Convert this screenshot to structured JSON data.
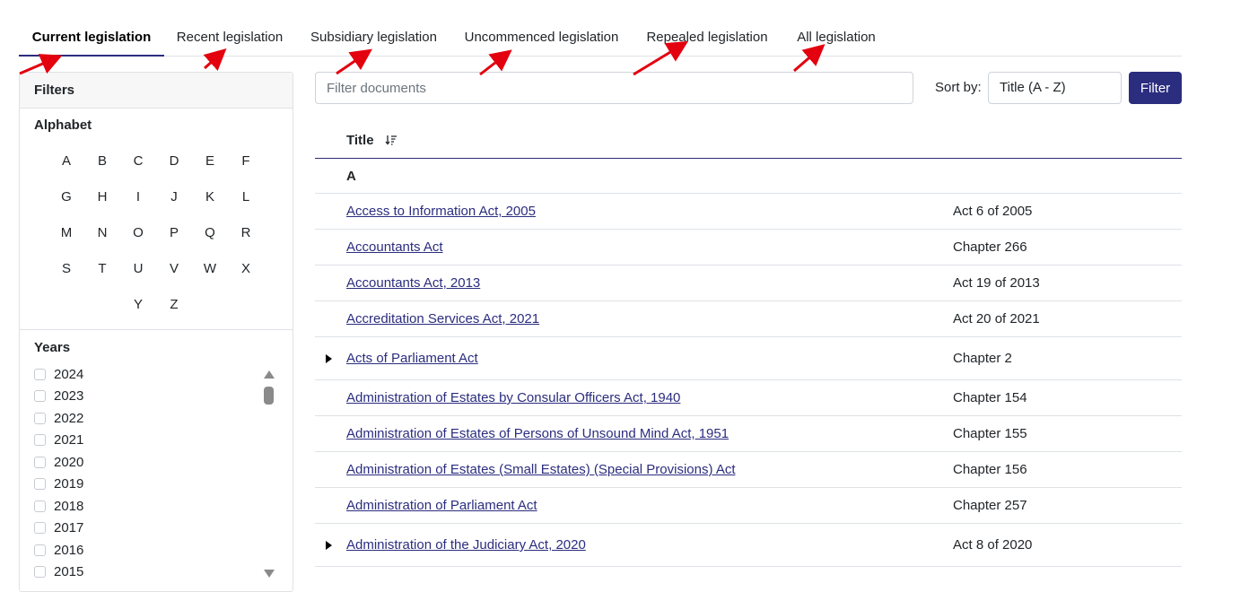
{
  "tabs": [
    {
      "label": "Current legislation",
      "active": true
    },
    {
      "label": "Recent legislation",
      "active": false
    },
    {
      "label": "Subsidiary legislation",
      "active": false
    },
    {
      "label": "Uncommenced legislation",
      "active": false
    },
    {
      "label": "Repealed legislation",
      "active": false
    },
    {
      "label": "All legislation",
      "active": false
    }
  ],
  "sidebar": {
    "title": "Filters",
    "alphabet_title": "Alphabet",
    "letters": [
      "A",
      "B",
      "C",
      "D",
      "E",
      "F",
      "G",
      "H",
      "I",
      "J",
      "K",
      "L",
      "M",
      "N",
      "O",
      "P",
      "Q",
      "R",
      "S",
      "T",
      "U",
      "V",
      "W",
      "X",
      "Y",
      "Z"
    ],
    "years_title": "Years",
    "years": [
      "2024",
      "2023",
      "2022",
      "2021",
      "2020",
      "2019",
      "2018",
      "2017",
      "2016",
      "2015"
    ]
  },
  "toolbar": {
    "search_placeholder": "Filter documents",
    "sort_label": "Sort by:",
    "sort_value": "Title (A - Z)",
    "filter_button": "Filter"
  },
  "table": {
    "header_title": "Title",
    "group_letter": "A",
    "rows": [
      {
        "title": "Access to Information Act, 2005",
        "number": "Act 6 of 2005",
        "expandable": false
      },
      {
        "title": "Accountants Act",
        "number": "Chapter 266",
        "expandable": false
      },
      {
        "title": "Accountants Act, 2013",
        "number": "Act 19 of 2013",
        "expandable": false
      },
      {
        "title": "Accreditation Services Act, 2021",
        "number": "Act 20 of 2021",
        "expandable": false
      },
      {
        "title": "Acts of Parliament Act",
        "number": "Chapter 2",
        "expandable": true
      },
      {
        "title": "Administration of Estates by Consular Officers Act, 1940",
        "number": "Chapter 154",
        "expandable": false
      },
      {
        "title": "Administration of Estates of Persons of Unsound Mind Act, 1951",
        "number": "Chapter 155",
        "expandable": false
      },
      {
        "title": "Administration of Estates (Small Estates) (Special Provisions) Act",
        "number": "Chapter 156",
        "expandable": false
      },
      {
        "title": "Administration of Parliament Act",
        "number": "Chapter 257",
        "expandable": false
      },
      {
        "title": "Administration of the Judiciary Act, 2020",
        "number": "Act 8 of 2020",
        "expandable": true
      }
    ]
  },
  "colors": {
    "accent": "#2b2d7f",
    "annotation_arrow": "#e3000f"
  }
}
